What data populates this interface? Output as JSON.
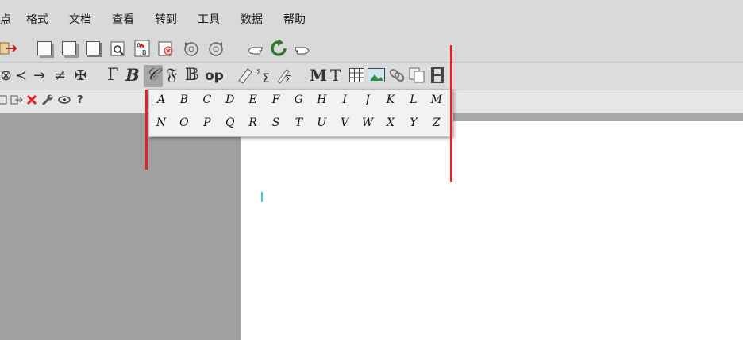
{
  "menubar": {
    "items": [
      "点",
      "格式",
      "文档",
      "查看",
      "转到",
      "工具",
      "数据",
      "帮助"
    ]
  },
  "toolbar2": {
    "bold_greek": "Γ",
    "bold_b": "B",
    "calligraphic": "𝒞",
    "fraktur": "𝔉",
    "blackboard": "𝔹",
    "op": "op",
    "bold_m": "M",
    "bold_t": "T",
    "arrow_symbols": [
      "⊗",
      "≺",
      "→",
      "≠",
      "✠"
    ]
  },
  "toolbar3": {
    "help_label": "?"
  },
  "calligraphic_popup": {
    "row1": [
      "A",
      "B",
      "C",
      "D",
      "E",
      "F",
      "G",
      "H",
      "I",
      "J",
      "K",
      "L",
      "M"
    ],
    "row2": [
      "N",
      "O",
      "P",
      "Q",
      "R",
      "S",
      "T",
      "U",
      "V",
      "W",
      "X",
      "Y",
      "Z"
    ]
  }
}
